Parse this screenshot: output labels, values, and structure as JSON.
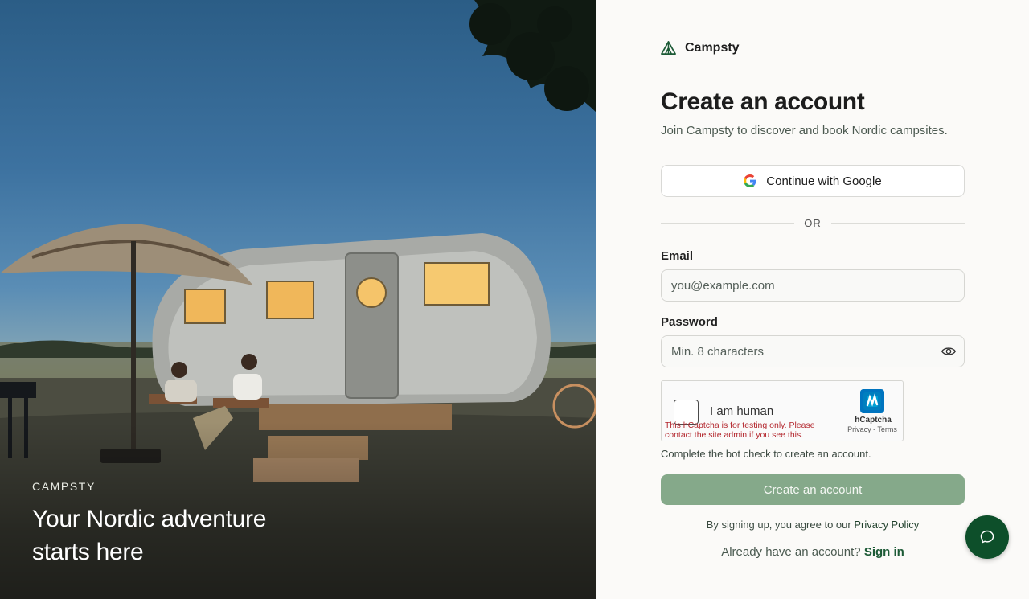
{
  "hero": {
    "kicker": "CAMPSTY",
    "title": "Your Nordic adventure starts here"
  },
  "brand": {
    "name": "Campsty",
    "icon": "tent-icon"
  },
  "form": {
    "title": "Create an account",
    "subtitle": "Join Campsty to discover and book Nordic campsites.",
    "google_label": "Continue with Google",
    "divider": "OR",
    "email_label": "Email",
    "email_placeholder": "you@example.com",
    "email_value": "",
    "password_label": "Password",
    "password_placeholder": "Min. 8 characters",
    "password_value": "",
    "captcha": {
      "label": "I am human",
      "warning": "This hCaptcha is for testing only. Please contact the site admin if you see this.",
      "brand": "hCaptcha",
      "links": "Privacy - Terms"
    },
    "bot_hint": "Complete the bot check to create an account.",
    "submit_label": "Create an account",
    "terms_prefix": "By signing up, you agree to our",
    "terms_link": "Privacy Policy",
    "signin_prefix": "Already have an account?",
    "signin_link": "Sign in"
  },
  "colors": {
    "accent": "#0d4f2a",
    "submit_disabled": "#85a98a",
    "error": "#b3262d"
  }
}
